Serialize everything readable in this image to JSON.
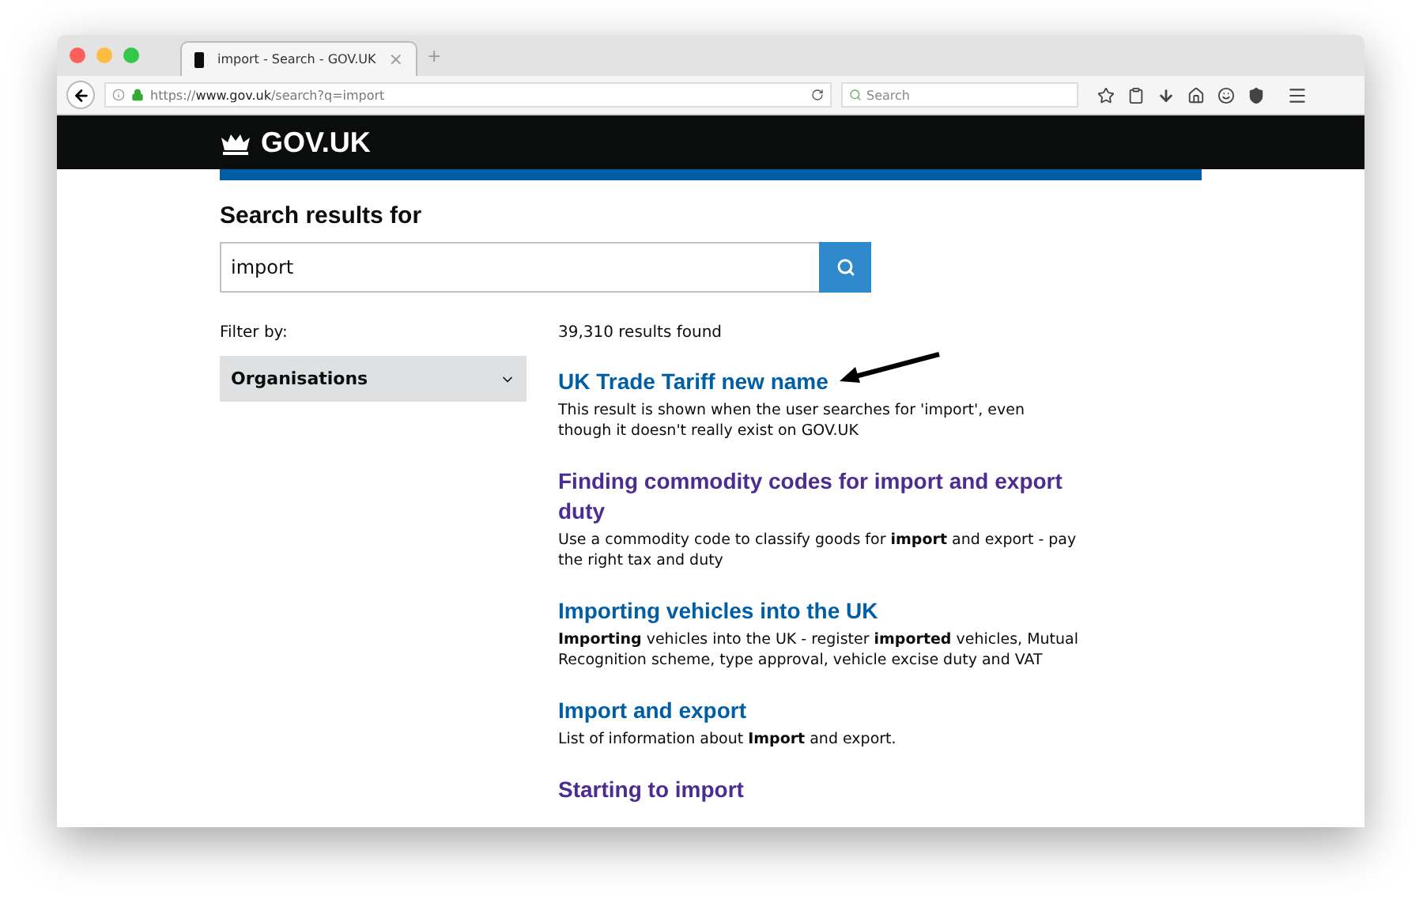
{
  "browser": {
    "tab_title": "import - Search - GOV.UK",
    "tab_close": "×",
    "new_tab": "+",
    "url_prefix": "https://",
    "url_host": "www.gov.uk",
    "url_path": "/search?q=import",
    "search_placeholder": "Search"
  },
  "header": {
    "logo": "GOV.UK"
  },
  "search": {
    "heading": "Search results for",
    "value": "import"
  },
  "filter": {
    "label": "Filter by:",
    "dropdown": "Organisations",
    "expanded": false
  },
  "results_count": "39,310 results found",
  "results": [
    {
      "title": "UK Trade Tariff new name",
      "visited": false,
      "description": "This result is shown when the user searches for 'import', even though it doesn't really exist on GOV.UK",
      "annotated": true
    },
    {
      "title": "Finding commodity codes for import and export duty",
      "visited": true,
      "description": "Use a commodity code to classify goods for **import** and export - pay the right tax and duty",
      "annotated": false
    },
    {
      "title": "Importing vehicles into the UK",
      "visited": false,
      "description": "**Importing** vehicles into the UK - register **imported** vehicles, Mutual Recognition scheme, type approval, vehicle excise duty and VAT",
      "annotated": false
    },
    {
      "title": "Import and export",
      "visited": false,
      "description": "List of information about **Import** and export.",
      "annotated": false
    },
    {
      "title": "Starting to import",
      "visited": true,
      "annotated": false
    }
  ]
}
